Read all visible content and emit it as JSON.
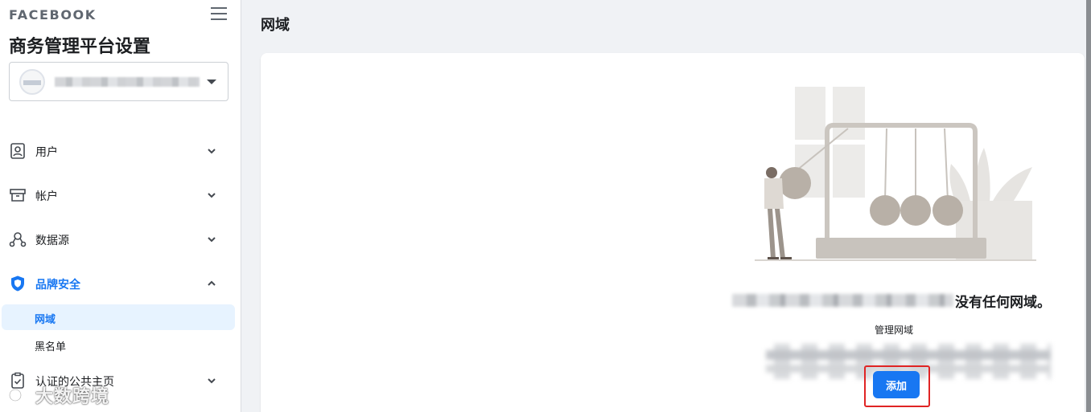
{
  "sidebar": {
    "brand": "FACEBOOK",
    "heading": "商务管理平台设置",
    "business_account": {
      "name": "████████████████ ."
    },
    "items": [
      {
        "label": "用户",
        "icon": "person-badge-icon",
        "expanded": false
      },
      {
        "label": "帐户",
        "icon": "archive-box-icon",
        "expanded": false
      },
      {
        "label": "数据源",
        "icon": "data-sources-icon",
        "expanded": false
      },
      {
        "label": "品牌安全",
        "icon": "shield-icon",
        "expanded": true,
        "children": [
          {
            "label": "网域",
            "selected": true
          },
          {
            "label": "黑名单",
            "selected": false
          }
        ]
      },
      {
        "label": "认证的公共主页",
        "icon": "clipboard-check-icon",
        "expanded": false
      }
    ]
  },
  "main": {
    "title": "网域",
    "empty_state": {
      "message": "没有任何网域。",
      "manage_label": "管理网域",
      "add_button": "添加"
    }
  },
  "watermark": {
    "text": "大数跨境"
  },
  "colors": {
    "accent": "#1877f2",
    "highlight": "#e02424",
    "page_bg": "#f0f2f5"
  }
}
